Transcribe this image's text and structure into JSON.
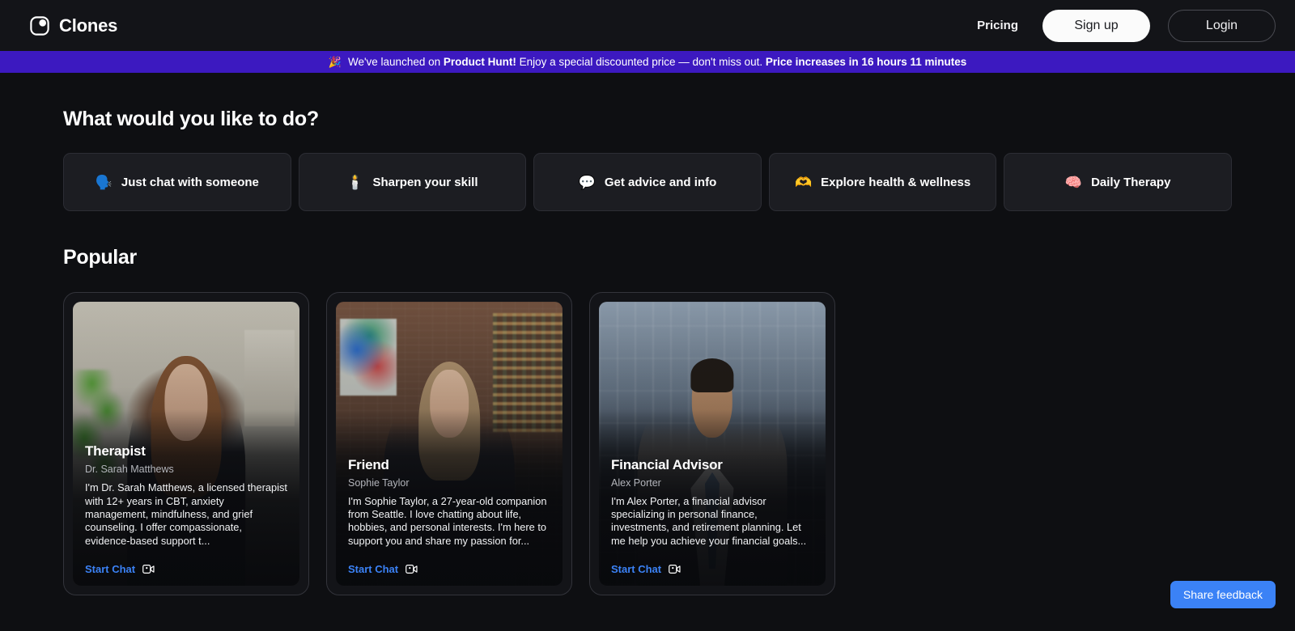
{
  "header": {
    "logo_icon": "clones-logo-icon",
    "brand": "Clones",
    "pricing_label": "Pricing",
    "signup_label": "Sign up",
    "login_label": "Login"
  },
  "banner": {
    "emoji": "🎉",
    "text_1": "We've launched on ",
    "bold_1": "Product Hunt!",
    "text_2": " Enjoy a special discounted price — don't miss out. ",
    "bold_2": "Price increases in 16 hours 11 minutes"
  },
  "main": {
    "prompt_title": "What would you like to do?",
    "popular_title": "Popular",
    "categories": [
      {
        "emoji": "🗣️",
        "icon": "speech-bubble-icon",
        "label": "Just chat with someone"
      },
      {
        "emoji": "🕯️",
        "icon": "candle-icon",
        "label": "Sharpen your skill"
      },
      {
        "emoji": "💬",
        "icon": "speech-balloon-icon",
        "label": "Get advice and info"
      },
      {
        "emoji": "🫶",
        "icon": "heart-hands-icon",
        "label": "Explore health & wellness"
      },
      {
        "emoji": "🧠",
        "icon": "brain-icon",
        "label": "Daily Therapy"
      }
    ],
    "cards": [
      {
        "title": "Therapist",
        "subtitle": "Dr. Sarah Matthews",
        "description": "I'm Dr. Sarah Matthews, a licensed therapist with 12+ years in CBT, anxiety management, mindfulness, and grief counseling. I offer compassionate, evidence-based support t...",
        "cta": "Start Chat"
      },
      {
        "title": "Friend",
        "subtitle": "Sophie Taylor",
        "description": "I'm Sophie Taylor, a 27-year-old companion from Seattle. I love chatting about life, hobbies, and personal interests. I'm here to support you and share my passion for...",
        "cta": "Start Chat"
      },
      {
        "title": "Financial Advisor",
        "subtitle": "Alex Porter",
        "description": "I'm Alex Porter, a financial advisor specializing in personal finance, investments, and retirement planning. Let me help you achieve your financial goals...",
        "cta": "Start Chat"
      }
    ]
  },
  "feedback": {
    "label": "Share feedback"
  },
  "colors": {
    "page_bg": "#0e0f12",
    "header_bg": "#131418",
    "banner_bg": "#3c19c0",
    "accent_blue": "#3b82f6",
    "card_bg": "#1c1d22",
    "card_border": "#2c2d34",
    "signup_bg": "#fbfbfb"
  }
}
